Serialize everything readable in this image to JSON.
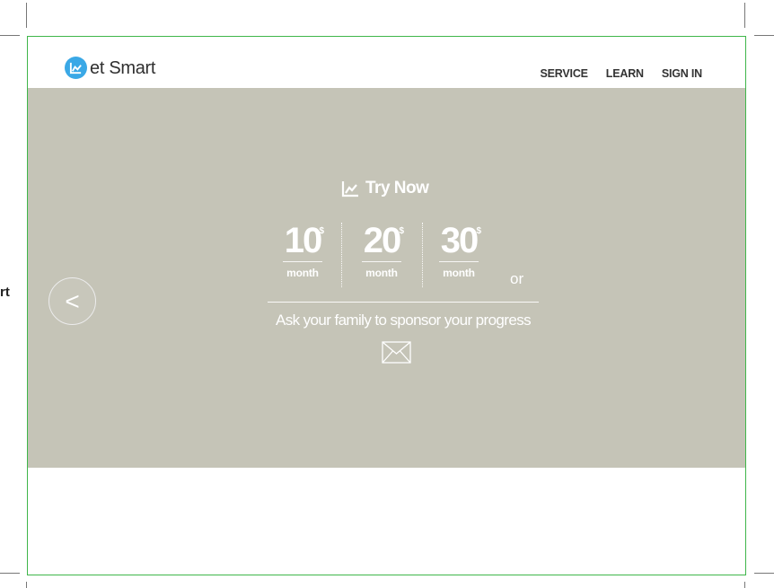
{
  "left_fragment": "rt",
  "brand": {
    "name": "et Smart",
    "logo_icon": "chart-icon",
    "logo_color": "#3aa8e6"
  },
  "nav": {
    "items": [
      "SERVICE",
      "LEARN",
      "SIGN IN"
    ]
  },
  "hero": {
    "background": "#c5c4b7",
    "prev_arrow": "<",
    "try_now": "Try Now",
    "plans": [
      {
        "amount": "10",
        "currency": "$",
        "period": "month"
      },
      {
        "amount": "20",
        "currency": "$",
        "period": "month"
      },
      {
        "amount": "30",
        "currency": "$",
        "period": "month"
      }
    ],
    "or_text": "or",
    "sponsor_text": "Ask your family to sponsor your progress",
    "mail_icon": "envelope-icon"
  },
  "colors": {
    "artboard_border": "#3fb64a",
    "text_dark": "#333333"
  }
}
